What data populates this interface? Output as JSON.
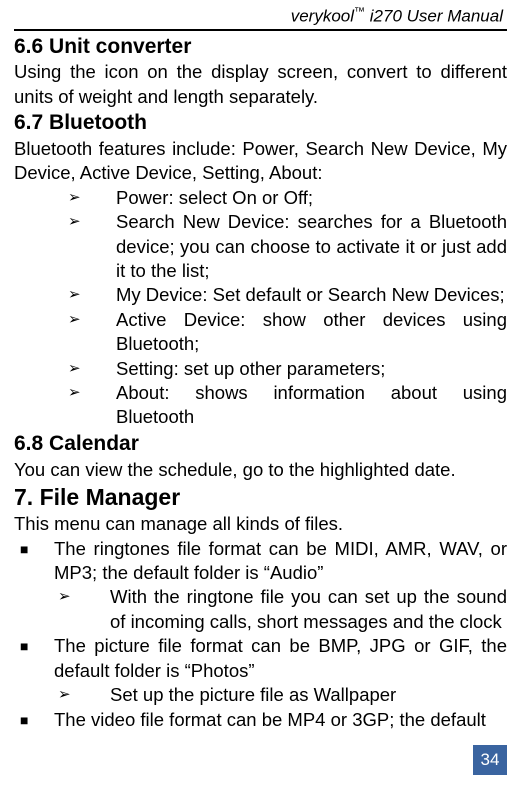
{
  "header": {
    "brand": "verykool",
    "tm": "™",
    "product": " i270 User Manual"
  },
  "sections": {
    "s66": {
      "title": "6.6 Unit converter",
      "body": "Using the icon on the display screen, convert to different units of weight and length separately."
    },
    "s67": {
      "title": "6.7 Bluetooth",
      "intro": "Bluetooth features include: Power, Search New Device, My Device, Active Device, Setting, About:",
      "items": [
        "Power: select On or Off;",
        "Search New Device: searches for a Bluetooth device; you can choose to activate it or just add it to the list;",
        "My Device: Set default or Search New Devices;",
        "Active Device: show other devices using Bluetooth;",
        "Setting: set up other parameters;",
        "About: shows information about using Bluetooth"
      ]
    },
    "s68": {
      "title": "6.8 Calendar",
      "body": "You can view the schedule, go to the highlighted date."
    },
    "s7": {
      "title": "7. File Manager",
      "intro": "This menu can manage all kinds of files.",
      "items": [
        {
          "text": "The ringtones file format can be MIDI, AMR, WAV, or MP3; the default folder is “Audio”",
          "sub": [
            "With the ringtone file you can set up the sound of incoming calls, short messages and the clock"
          ]
        },
        {
          "text": "The picture file format can be BMP, JPG or GIF, the default folder is “Photos”",
          "sub": [
            "Set up the picture file as Wallpaper"
          ]
        },
        {
          "text": "The video file format can be MP4 or 3GP; the default"
        }
      ]
    }
  },
  "pageNumber": "34"
}
